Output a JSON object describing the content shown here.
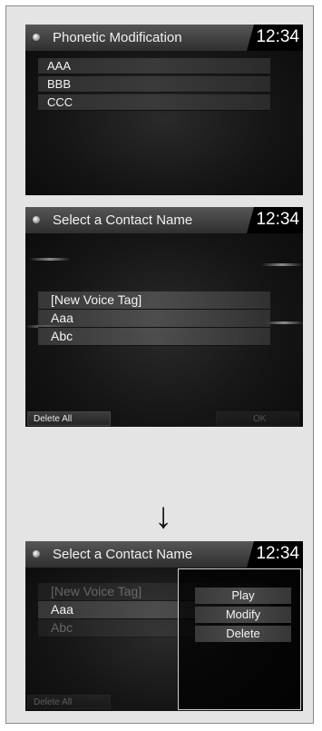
{
  "screen1": {
    "title": "Phonetic Modification",
    "clock": "12:34",
    "items": [
      "AAA",
      "BBB",
      "CCC"
    ]
  },
  "screen2": {
    "title": "Select a Contact Name",
    "clock": "12:34",
    "items": [
      "[New Voice Tag]",
      "Aaa",
      "Abc"
    ],
    "softkeys": {
      "left": "Delete All",
      "right": "OK"
    }
  },
  "screen3": {
    "title": "Select a Contact Name",
    "clock": "12:34",
    "items": [
      "[New Voice Tag]",
      "Aaa",
      "Abc"
    ],
    "softkeys": {
      "left": "Delete All"
    },
    "popup_menu": [
      "Play",
      "Modify",
      "Delete"
    ]
  },
  "arrows": [
    "↓",
    "↓"
  ]
}
